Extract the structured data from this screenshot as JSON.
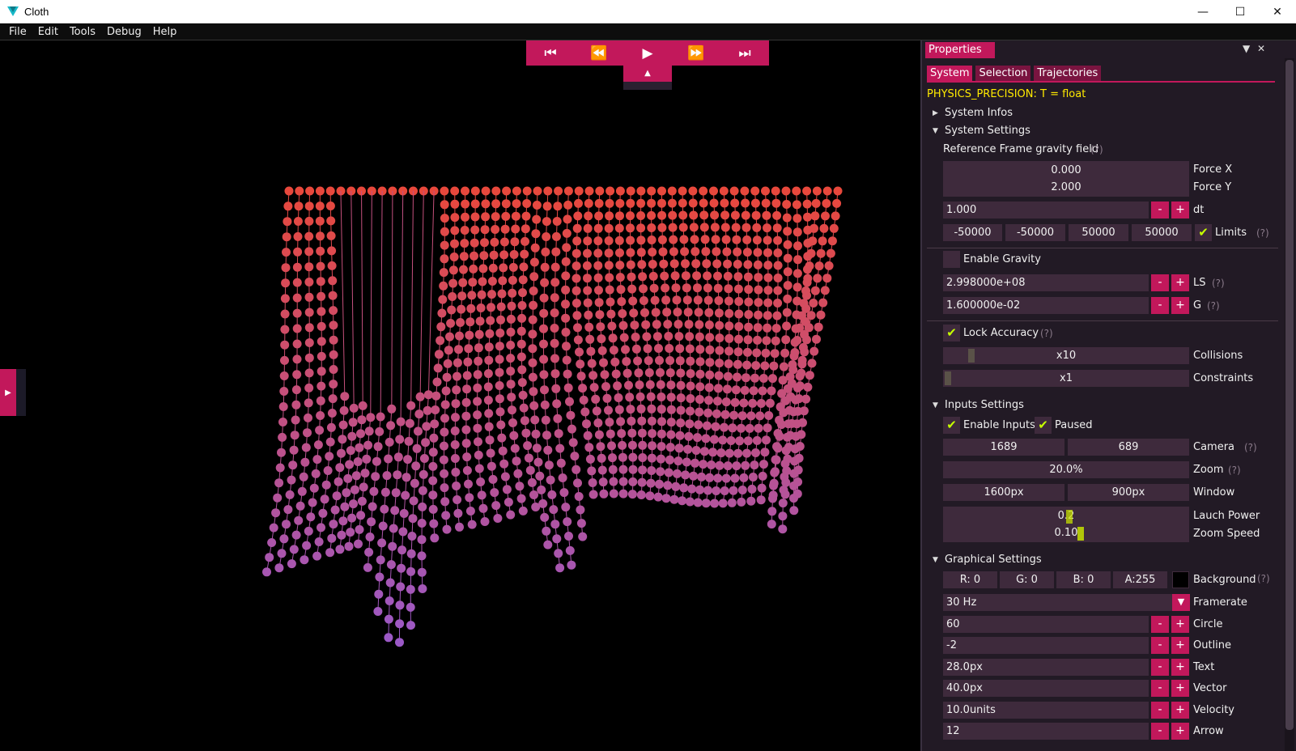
{
  "window": {
    "title": "Cloth",
    "minimize": "—",
    "maximize": "☐",
    "close": "✕"
  },
  "menu": [
    "File",
    "Edit",
    "Tools",
    "Debug",
    "Help"
  ],
  "transport": {
    "first": "⏮",
    "back": "⏪",
    "play": "▶",
    "forward": "⏩",
    "last": "⏭",
    "toggle": "▲"
  },
  "side_tab": "▶",
  "panel": {
    "title": "Properties",
    "tabs": [
      "System",
      "Selection",
      "Trajectories"
    ],
    "active_tab": "System",
    "precision": "PHYSICS_PRECISION: T = float",
    "system_infos": "System Infos",
    "system_settings": {
      "header": "System Settings",
      "gravity_field_label": "Reference Frame gravity field",
      "force_x": "0.000",
      "force_x_label": "Force X",
      "force_y": "2.000",
      "force_y_label": "Force Y",
      "dt": "1.000",
      "dt_label": "dt",
      "limits": [
        "-50000",
        "-50000",
        "50000",
        "50000"
      ],
      "limits_label": "Limits",
      "enable_gravity": "Enable Gravity",
      "ls": "2.998000e+08",
      "ls_label": "LS",
      "g": "1.600000e-02",
      "g_label": "G",
      "lock_accuracy": "Lock Accuracy",
      "collisions": "x10",
      "collisions_label": "Collisions",
      "collisions_level": 0.1,
      "constraints": "x1",
      "constraints_label": "Constraints",
      "constraints_level": 0.0
    },
    "inputs_settings": {
      "header": "Inputs Settings",
      "enable_inputs": "Enable Inputs",
      "paused": "Paused",
      "camera": [
        "1689",
        "689"
      ],
      "camera_label": "Camera",
      "zoom": "20.0%",
      "zoom_label": "Zoom",
      "window": [
        "1600px",
        "900px"
      ],
      "window_label": "Window",
      "launch_power": "0.2",
      "launch_power_label": "Lauch Power",
      "zoom_speed": "0.10",
      "zoom_speed_label": "Zoom Speed"
    },
    "graphical_settings": {
      "header": "Graphical Settings",
      "r": "R: 0",
      "g": "G: 0",
      "b": "B: 0",
      "a": "A:255",
      "background_label": "Background",
      "framerate": "30 Hz",
      "framerate_label": "Framerate",
      "circle": "60",
      "circle_label": "Circle",
      "outline": "-2",
      "outline_label": "Outline",
      "text": "28.0px",
      "text_label": "Text",
      "vector": "40.0px",
      "vector_label": "Vector",
      "velocity": "10.0units",
      "velocity_label": "Velocity",
      "arrow": "12",
      "arrow_label": "Arrow"
    },
    "help_mark": "(?)",
    "minus": "-",
    "plus": "+",
    "check": "✔",
    "collapsed": "▶",
    "expanded": "▼"
  },
  "colors": {
    "accent": "#c2185b",
    "check": "#c6ff00",
    "cloth_top": "#e8483c",
    "cloth_bottom": "#9b59c8",
    "precision_text": "#ffea00"
  }
}
